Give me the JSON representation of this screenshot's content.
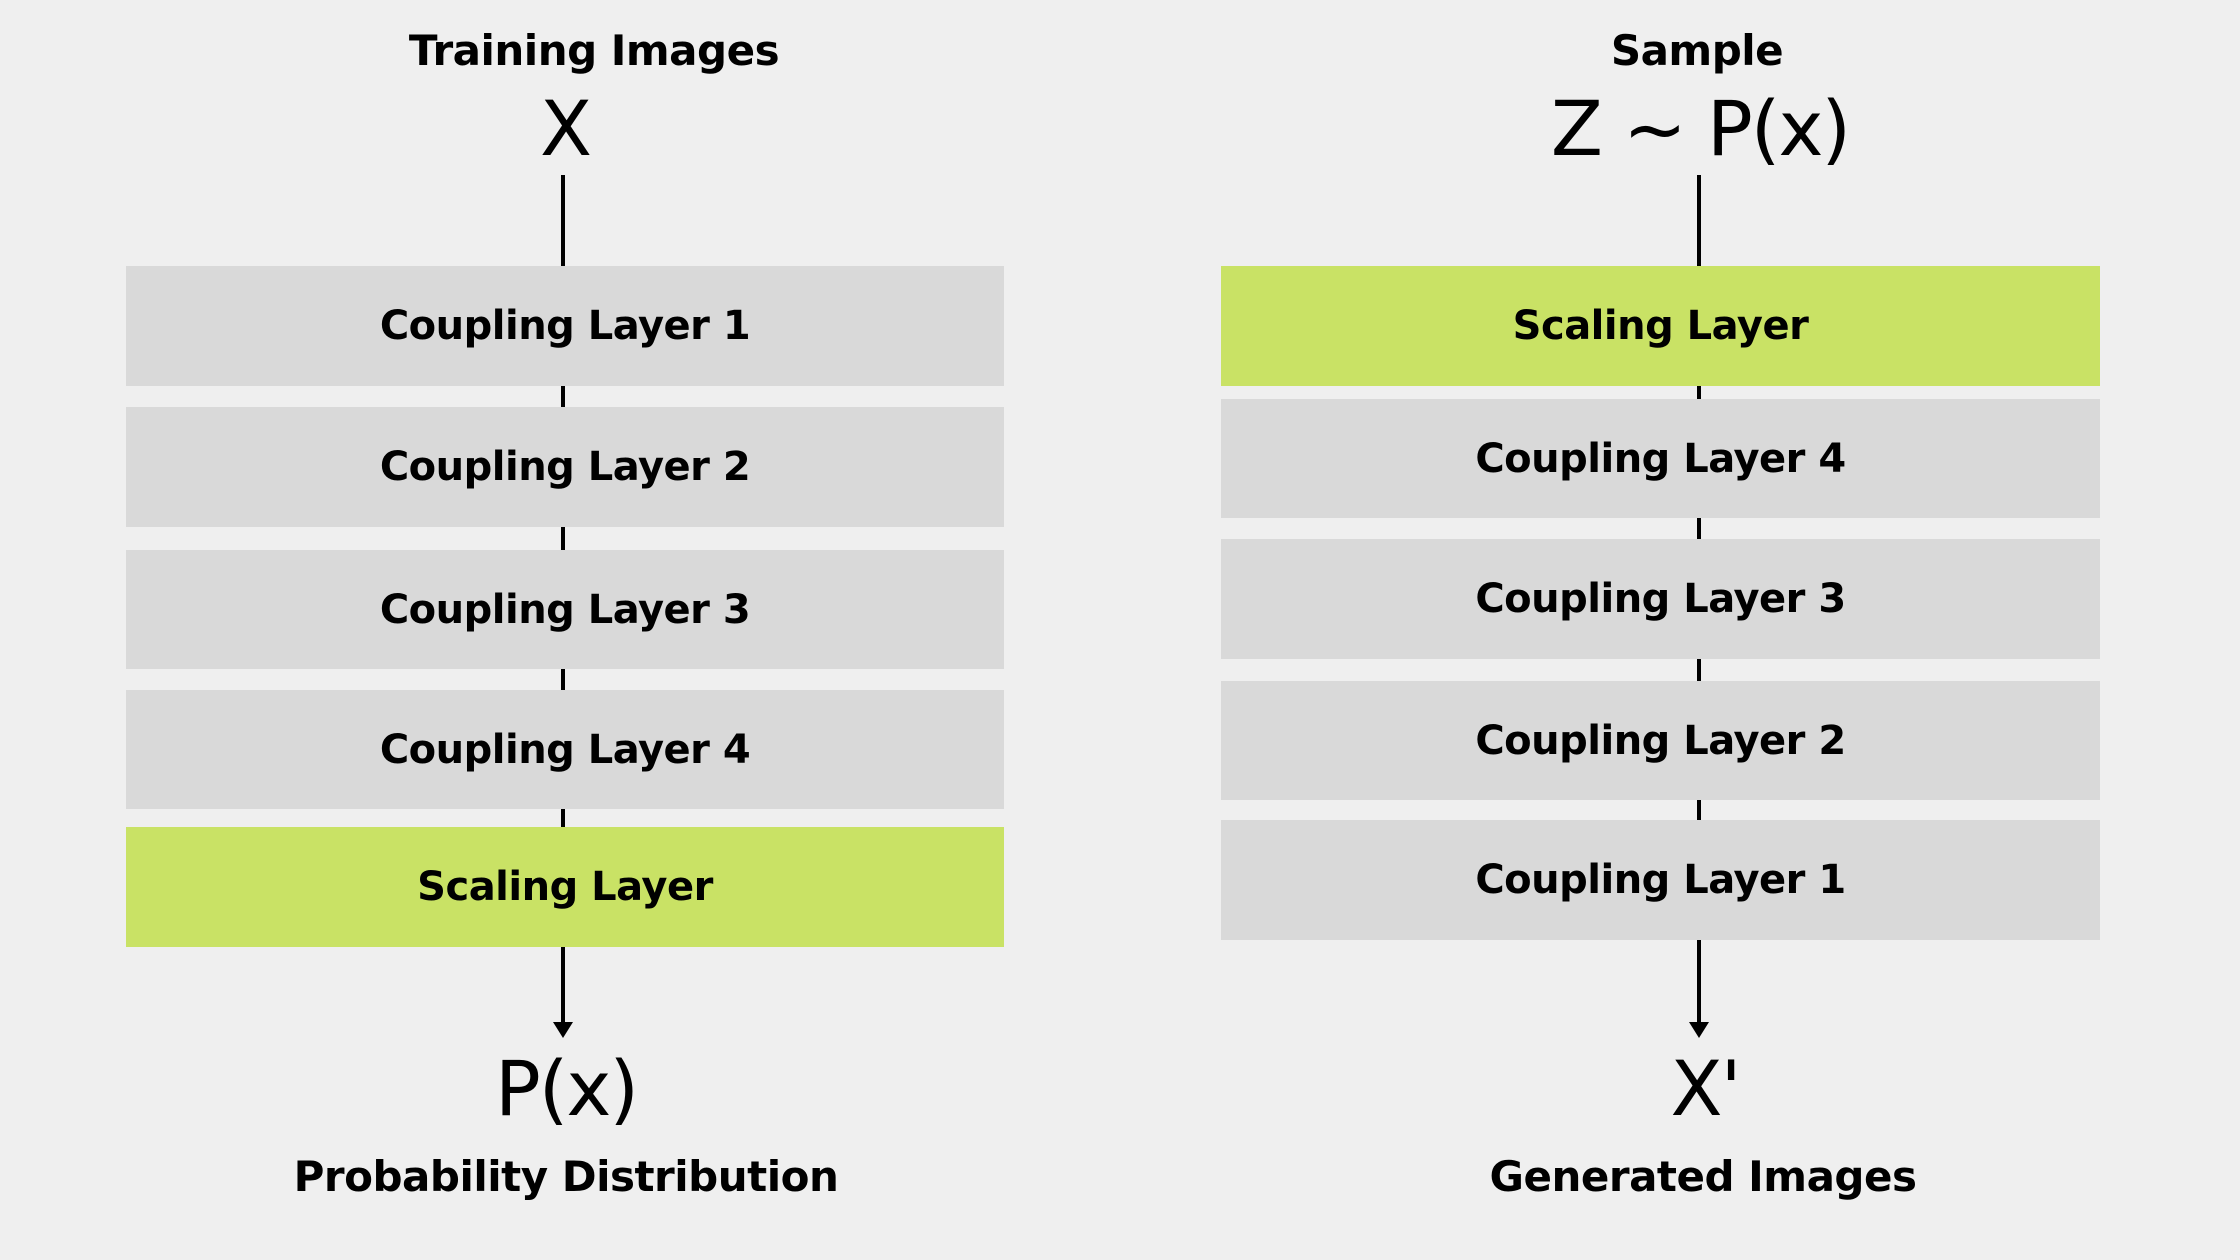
{
  "left_column": {
    "title": "Training Images",
    "input_symbol": "X",
    "layers": [
      {
        "label": "Coupling Layer 1",
        "type": "coupling"
      },
      {
        "label": "Coupling Layer 2",
        "type": "coupling"
      },
      {
        "label": "Coupling Layer 3",
        "type": "coupling"
      },
      {
        "label": "Coupling Layer 4",
        "type": "coupling"
      },
      {
        "label": "Scaling Layer",
        "type": "scaling"
      }
    ],
    "output_symbol": "P(x)",
    "output_label": "Probability Distribution"
  },
  "right_column": {
    "title": "Sample",
    "input_symbol": "Z ~ P(x)",
    "layers": [
      {
        "label": "Scaling Layer",
        "type": "scaling"
      },
      {
        "label": "Coupling Layer 4",
        "type": "coupling"
      },
      {
        "label": "Coupling Layer 3",
        "type": "coupling"
      },
      {
        "label": "Coupling Layer 2",
        "type": "coupling"
      },
      {
        "label": "Coupling Layer 1",
        "type": "coupling"
      }
    ],
    "output_symbol": "X'",
    "output_label": "Generated Images"
  },
  "colors": {
    "background": "#efefef",
    "coupling_layer": "#d9d9d9",
    "scaling_layer": "#c9e265",
    "line": "#000000"
  }
}
